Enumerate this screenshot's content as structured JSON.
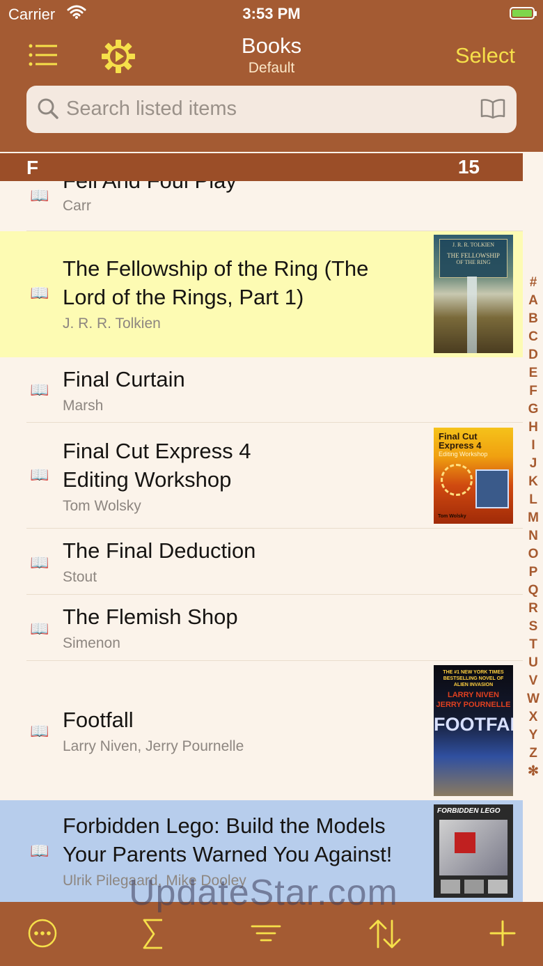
{
  "status": {
    "carrier": "Carrier",
    "time": "3:53 PM"
  },
  "nav": {
    "title": "Books",
    "subtitle": "Default",
    "select": "Select"
  },
  "search": {
    "placeholder": "Search listed items"
  },
  "section": {
    "letter": "F",
    "count": "15"
  },
  "rows": [
    {
      "title_lines": [
        "Fell And Foul Play"
      ],
      "author": "Carr",
      "bg": "#fbf3ea"
    },
    {
      "title_lines": [
        "The Fellowship of the Ring (The",
        "Lord of the Rings, Part 1)"
      ],
      "author": "J. R. R. Tolkien",
      "bg": "#fdfbb3",
      "cover": {
        "line1": "J. R. R. TOLKIEN",
        "line2": "THE FELLOWSHIP",
        "line3": "OF THE RING"
      }
    },
    {
      "title_lines": [
        "Final Curtain"
      ],
      "author": "Marsh",
      "bg": "#fbf3ea"
    },
    {
      "title_lines": [
        "Final Cut Express 4",
        "Editing Workshop"
      ],
      "author": "Tom Wolsky",
      "bg": "#fbf3ea",
      "cover": {
        "line1": "Final Cut",
        "line2": "Express 4",
        "line3": "Editing Workshop",
        "line4": "Tom Wolsky"
      }
    },
    {
      "title_lines": [
        "The Final Deduction"
      ],
      "author": "Stout",
      "bg": "#fbf3ea"
    },
    {
      "title_lines": [
        "The Flemish Shop"
      ],
      "author": "Simenon",
      "bg": "#fbf3ea"
    },
    {
      "title_lines": [
        "Footfall"
      ],
      "author": "Larry Niven, Jerry Pournelle",
      "bg": "#fbf3ea",
      "cover": {
        "line1": "THE #1 NEW YORK TIMES",
        "line2": "BESTSELLING NOVEL OF",
        "line3": "ALIEN INVASION",
        "line4": "LARRY NIVEN",
        "line5": "JERRY POURNELLE",
        "line6": "FOOTFALL"
      }
    },
    {
      "title_lines": [
        "Forbidden Lego: Build the Models",
        "Your Parents Warned You Against!"
      ],
      "author": "Ulrik Pilegaard, Mike Dooley",
      "bg": "#b7cdec",
      "cover": {
        "line1": "FORBIDDEN LEGO"
      }
    }
  ],
  "index": [
    "#",
    "A",
    "B",
    "C",
    "D",
    "E",
    "F",
    "G",
    "H",
    "I",
    "J",
    "K",
    "L",
    "M",
    "N",
    "O",
    "P",
    "Q",
    "R",
    "S",
    "T",
    "U",
    "V",
    "W",
    "X",
    "Y",
    "Z",
    "✻"
  ],
  "toolbar": {
    "items": [
      "more-icon",
      "sum-icon",
      "filter-icon",
      "sort-icon",
      "add-icon"
    ]
  },
  "watermark": "UpdateStar.com",
  "colors": {
    "navbar": "#a45b33",
    "section": "#9b4e28",
    "accent": "#f6e04a",
    "highlight_yellow": "#fdfbb3",
    "highlight_blue": "#b7cdec"
  }
}
